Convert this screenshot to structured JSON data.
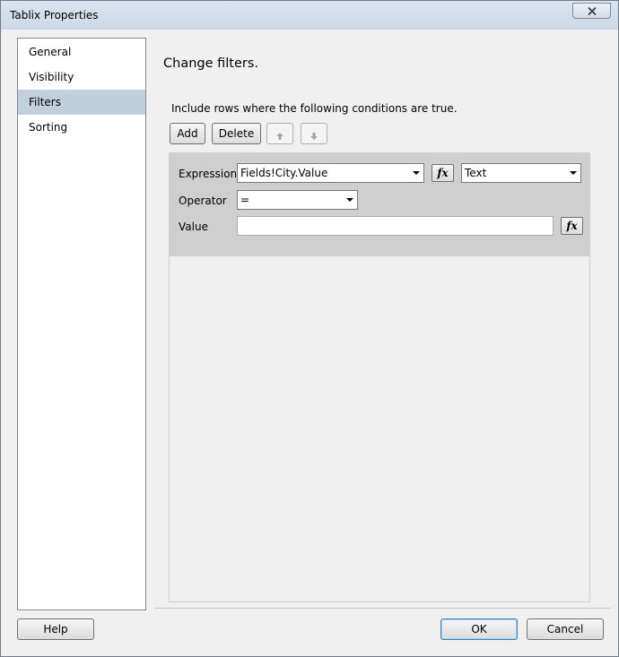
{
  "window": {
    "title": "Tablix Properties"
  },
  "nav": {
    "items": [
      {
        "label": "General"
      },
      {
        "label": "Visibility"
      },
      {
        "label": "Filters"
      },
      {
        "label": "Sorting"
      }
    ],
    "selected": "Filters"
  },
  "page": {
    "heading": "Change filters.",
    "description": "Include rows where the following conditions are true."
  },
  "toolbar": {
    "add_label": "Add",
    "delete_label": "Delete",
    "move_up_icon": "arrow-up-icon",
    "move_down_icon": "arrow-down-icon"
  },
  "filter": {
    "expression_label": "Expression",
    "expression_value": "Fields!City.Value",
    "type_value": "Text",
    "operator_label": "Operator",
    "operator_value": "=",
    "value_label": "Value",
    "value_value": "",
    "fx_label": "fx"
  },
  "footer": {
    "help_label": "Help",
    "ok_label": "OK",
    "cancel_label": "Cancel"
  },
  "colors": {
    "selected_nav": "#c2cfdc",
    "filter_row_bg": "#cfcfcf",
    "default_button_border": "#3c7fb1"
  }
}
